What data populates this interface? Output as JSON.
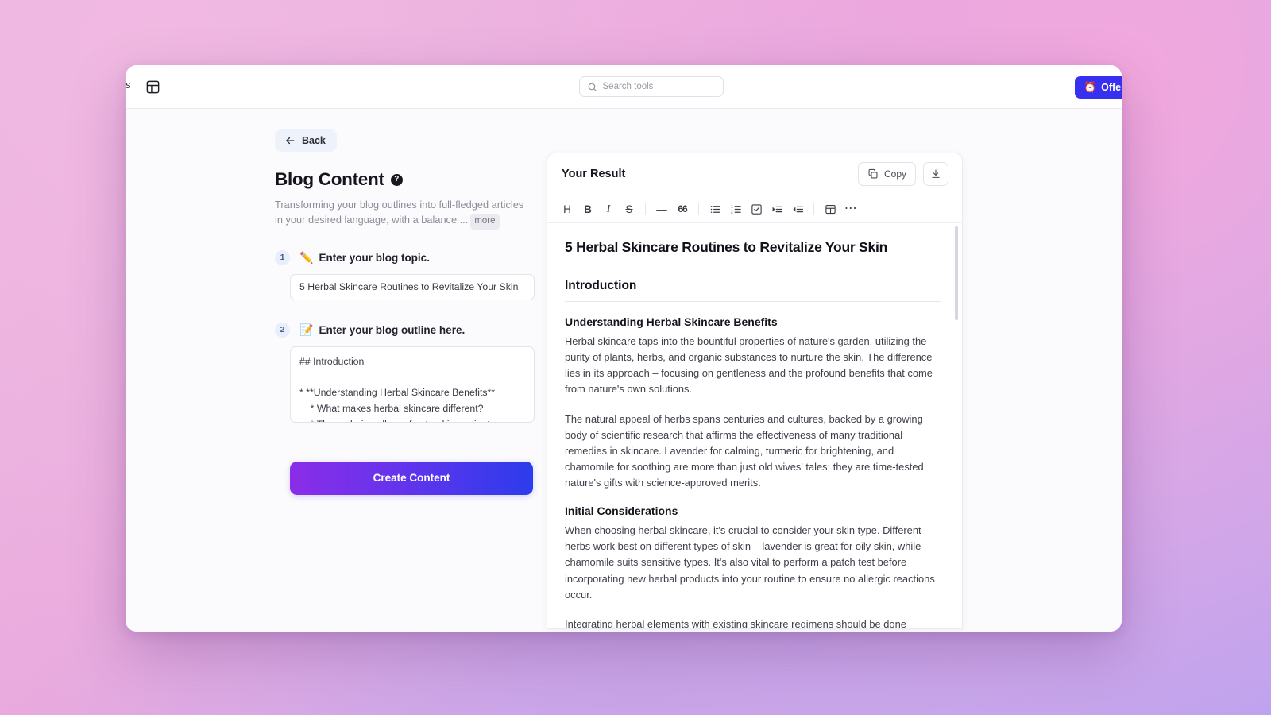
{
  "topbar": {
    "panel_toggle_icon": "panel-layout-icon",
    "search": {
      "placeholder": "Search tools",
      "value": ""
    },
    "offer_button": {
      "emoji": "⏰",
      "label": "Offer"
    },
    "edge_sliver_text": "s"
  },
  "form": {
    "back_label": "Back",
    "title": "Blog Content",
    "help_glyph": "?",
    "description": "Transforming your blog outlines into full-fledged articles in your desired language, with a balance ...",
    "more_label": "more",
    "steps": [
      {
        "number": "1",
        "emoji": "✏️",
        "label": "Enter your blog topic.",
        "value": "5 Herbal Skincare Routines to Revitalize Your Skin",
        "placeholder": "Enter your blog topic."
      },
      {
        "number": "2",
        "emoji": "📝",
        "label": "Enter your blog outline here.",
        "value": "## Introduction\n\n* **Understanding Herbal Skincare Benefits**\n    * What makes herbal skincare different?\n    * The enduring allure of natural ingredients",
        "placeholder": "Enter your blog outline here."
      }
    ],
    "submit_label": "Create Content"
  },
  "result": {
    "title": "Your Result",
    "copy_label": "Copy",
    "download_icon": "download-icon",
    "toolbar": [
      {
        "name": "heading",
        "glyph": "H",
        "style": "txt"
      },
      {
        "name": "bold",
        "glyph": "B",
        "style": "bold"
      },
      {
        "name": "italic",
        "glyph": "I",
        "style": "ital"
      },
      {
        "name": "strikethrough",
        "glyph": "S",
        "style": "strike"
      },
      {
        "name": "separator-1",
        "glyph": "",
        "style": "sep"
      },
      {
        "name": "horizontal-rule",
        "glyph": "—",
        "style": "txt"
      },
      {
        "name": "blockquote",
        "glyph": "66",
        "style": "quote"
      },
      {
        "name": "separator-2",
        "glyph": "",
        "style": "sep"
      },
      {
        "name": "bulleted-list",
        "glyph": "",
        "style": "svg-bullet"
      },
      {
        "name": "numbered-list",
        "glyph": "",
        "style": "svg-number"
      },
      {
        "name": "checklist",
        "glyph": "",
        "style": "svg-check"
      },
      {
        "name": "indent",
        "glyph": "",
        "style": "svg-indent"
      },
      {
        "name": "outdent",
        "glyph": "",
        "style": "svg-outdent"
      },
      {
        "name": "separator-3",
        "glyph": "",
        "style": "sep"
      },
      {
        "name": "table",
        "glyph": "",
        "style": "svg-table"
      },
      {
        "name": "more-options",
        "glyph": "⋯",
        "style": "dots"
      }
    ],
    "document": {
      "h1": "5 Herbal Skincare Routines to Revitalize Your Skin",
      "h2": "Introduction",
      "section1_heading": "Understanding Herbal Skincare Benefits",
      "section1_p1": "Herbal skincare taps into the bountiful properties of nature's garden, utilizing the purity of plants, herbs, and organic substances to nurture the skin. The difference lies in its approach – focusing on gentleness and the profound benefits that come from nature's own solutions.",
      "section1_p2": "The natural appeal of herbs spans centuries and cultures, backed by a growing body of scientific research that affirms the effectiveness of many traditional remedies in skincare. Lavender for calming, turmeric for brightening, and chamomile for soothing are more than just old wives' tales; they are time-tested nature's gifts with science-approved merits.",
      "section2_heading": "Initial Considerations",
      "section2_p1": "When choosing herbal skincare, it's crucial to consider your skin type. Different herbs work best on different types of skin – lavender is great for oily skin, while chamomile suits sensitive types. It's also vital to perform a patch test before incorporating new herbal products into your routine to ensure no allergic reactions occur.",
      "section2_p2": "Integrating herbal elements with existing skincare regimens should be done gradually and thoughtfully, ensuring your skin adapts well without overwhelming"
    }
  },
  "colors": {
    "accent_blue": "#3730f0",
    "gradient_start": "#8b2de8",
    "gradient_end": "#2c3cec",
    "step_badge_bg": "#e8eefb"
  }
}
